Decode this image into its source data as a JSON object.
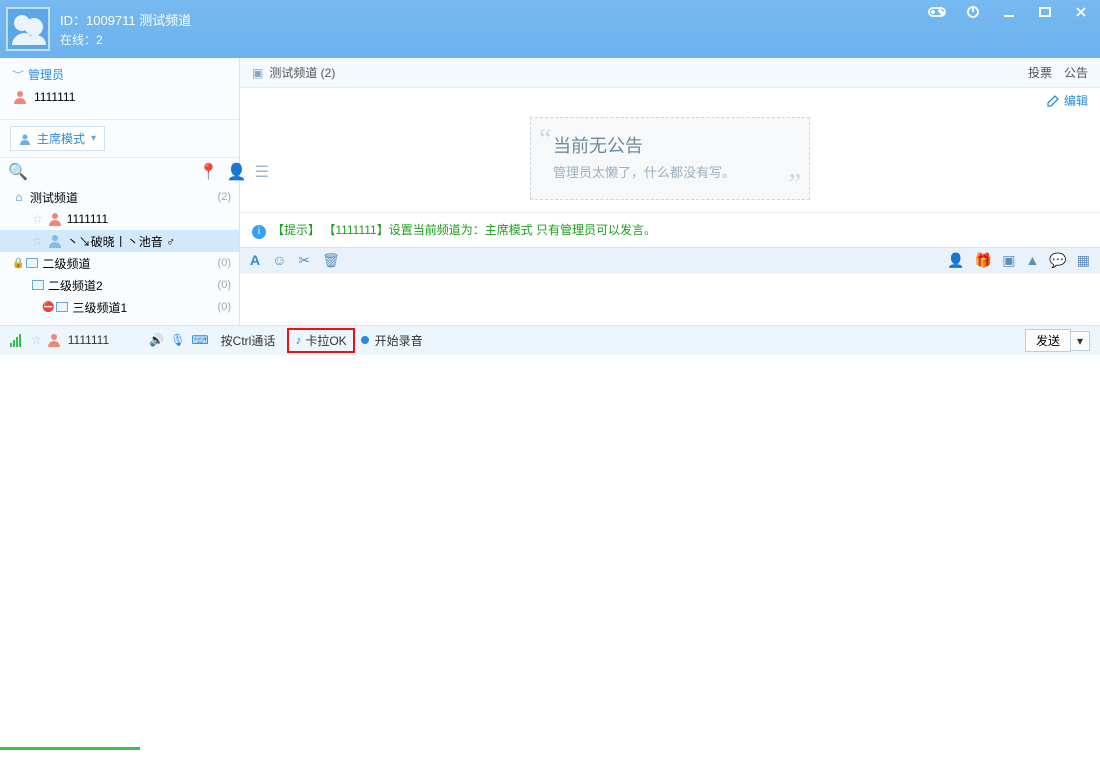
{
  "header": {
    "id_label": "ID：",
    "id_value": "1009711",
    "channel_name": "测试频道",
    "online_label": "在线：",
    "online_count": "2"
  },
  "sidebar": {
    "admin_section": "管理员",
    "admin_user": "1111111",
    "mode_button": "主席模式",
    "search_placeholder": "",
    "tree": [
      {
        "name": "测试频道",
        "count": "(2)"
      },
      {
        "name": "1111111"
      },
      {
        "name": "丶↘破晓丨丶池音 ♂"
      },
      {
        "name": "二级频道",
        "count": "(0)"
      },
      {
        "name": "二级频道2",
        "count": "(0)"
      },
      {
        "name": "三级频道1",
        "count": "(0)"
      }
    ]
  },
  "chat": {
    "breadcrumb": "测试频道 (2)",
    "link_vote": "投票",
    "link_bulletin": "公告",
    "edit_label": "编辑",
    "notice_title": "当前无公告",
    "notice_sub": "管理员太懒了，什么都没有写。",
    "tip": "【提示】 【1111111】设置当前频道为：主席模式 只有管理员可以发言。"
  },
  "footer": {
    "user": "1111111",
    "ptt_label": "按Ctrl通话",
    "karaoke_label": "卡拉OK",
    "record_label": "开始录音",
    "send_label": "发送"
  }
}
